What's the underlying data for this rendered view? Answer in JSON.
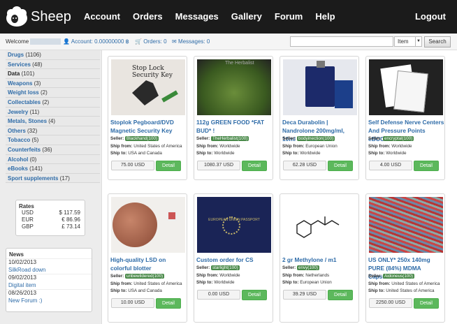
{
  "nav": {
    "logo": "Sheep",
    "links": [
      "Account",
      "Orders",
      "Messages",
      "Gallery",
      "Forum",
      "Help"
    ],
    "logout": "Logout"
  },
  "bar": {
    "welcome": "Welcome",
    "account_label": "Account:",
    "account_value": "0.00000000 ฿",
    "orders_label": "Orders:",
    "orders_value": "0",
    "messages_label": "Messages:",
    "messages_value": "0",
    "search_placeholder": "",
    "select_value": "Item",
    "search_button": "Search"
  },
  "categories": [
    {
      "name": "Drugs",
      "count": "(1106)"
    },
    {
      "name": "Services",
      "count": "(48)"
    },
    {
      "name": "Data",
      "count": "(101)"
    },
    {
      "name": "Weapons",
      "count": "(3)"
    },
    {
      "name": "Weight loss",
      "count": "(2)"
    },
    {
      "name": "Collectables",
      "count": "(2)"
    },
    {
      "name": "Jewelry",
      "count": "(11)"
    },
    {
      "name": "Metals, Stones",
      "count": "(4)"
    },
    {
      "name": "Others",
      "count": "(32)"
    },
    {
      "name": "Tobacco",
      "count": "(5)"
    },
    {
      "name": "Counterfeits",
      "count": "(36)"
    },
    {
      "name": "Alcohol",
      "count": "(0)"
    },
    {
      "name": "eBooks",
      "count": "(141)"
    },
    {
      "name": "Sport supplements",
      "count": "(17)"
    }
  ],
  "rates": {
    "title": "Rates",
    "rows": [
      {
        "c": "USD",
        "v": "$ 117.59"
      },
      {
        "c": "EUR",
        "v": "€ 86.96"
      },
      {
        "c": "GBP",
        "v": "£ 73.14"
      }
    ]
  },
  "news": {
    "title": "News",
    "items": [
      {
        "date": "10/02/2013",
        "text": "SilkRoad down"
      },
      {
        "date": "09/02/2013",
        "text": "Digital item"
      },
      {
        "date": "08/26/2013",
        "text": "New Forum :)"
      }
    ]
  },
  "labels": {
    "seller": "Seller:",
    "ship_from": "Ship from:",
    "ship_to": "Ship to:",
    "detail": "Detail"
  },
  "products": [
    {
      "title": "Stoplok Pegboard/DVD Magnetic Security Key",
      "seller": "Blackhand(100)",
      "from": "United States of America",
      "to": "USA and Canada",
      "price": "75.00 USD",
      "img_text": "Stop Lock Security Key"
    },
    {
      "title": "112g GREEN FOOD *FAT BUD* !",
      "seller": "TheHerbalist(100)",
      "from": "Worldwide",
      "to": "Worldwide",
      "price": "1080.37 USD",
      "img_text": "The Herbalist"
    },
    {
      "title": "Deca Durabolin | Nandrolone 200mg/ml, 10ml",
      "seller": "bodyinection(100)",
      "from": "European Union",
      "to": "Worldwide",
      "price": "62.28 USD",
      "img_text": ""
    },
    {
      "title": "Self Defense Nerve Centers And Pressure Points eBOOK",
      "seller": "encryptal(100)",
      "from": "Worldwide",
      "to": "Worldwide",
      "price": "4.00 USD",
      "img_text": ""
    },
    {
      "title": "High-quality LSD on colorful blotter",
      "seller": "unbewildered(100)",
      "from": "United States of America",
      "to": "USA and Canada",
      "price": "10.00 USD",
      "img_text": ""
    },
    {
      "title": "Custom order for CS",
      "seller": "starlight(100)",
      "from": "Worldwide",
      "to": "Worldwide",
      "price": "0.00 USD",
      "img_text": "EUROPEAN UNION PASSPORT"
    },
    {
      "title": "2 gr Methylone / m1",
      "seller": "envy(100)",
      "from": "Netherlands",
      "to": "European Union",
      "price": "39.29 USD",
      "img_text": ""
    },
    {
      "title": "US ONLY* 250x 140mg PURE (84%) MDMA Capsules",
      "seller": "Aidoneus(100)",
      "from": "United States of America",
      "to": "United States of America",
      "price": "2250.00 USD",
      "img_text": ""
    }
  ]
}
